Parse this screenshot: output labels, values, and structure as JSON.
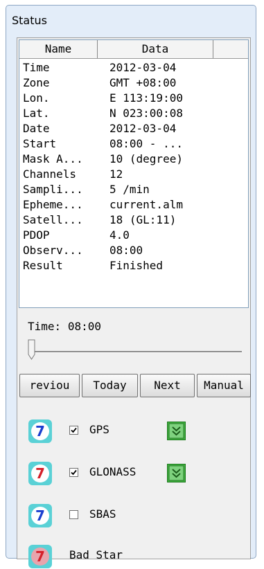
{
  "panel": {
    "title": "Status"
  },
  "list": {
    "columns": [
      "Name",
      "Data"
    ],
    "rows": [
      {
        "name": "Time",
        "value": "2012-03-04"
      },
      {
        "name": "Zone",
        "value": "GMT +08:00"
      },
      {
        "name": "Lon.",
        "value": "E 113:19:00"
      },
      {
        "name": "Lat.",
        "value": "N 023:00:08"
      },
      {
        "name": "Date",
        "value": "2012-03-04"
      },
      {
        "name": "Start",
        "value": "08:00 - ..."
      },
      {
        "name": "Mask A...",
        "value": "10 (degree)"
      },
      {
        "name": "Channels",
        "value": "12"
      },
      {
        "name": "Sampli...",
        "value": "5 /min"
      },
      {
        "name": "Epheme...",
        "value": "current.alm"
      },
      {
        "name": "Satell...",
        "value": "18 (GL:11)"
      },
      {
        "name": "PDOP",
        "value": "4.0"
      },
      {
        "name": "Observ...",
        "value": "08:00"
      },
      {
        "name": "Result",
        "value": "Finished"
      }
    ]
  },
  "time": {
    "label": "Time:",
    "value": "08:00",
    "slider_fraction": 0.0
  },
  "buttons": {
    "previous": "reviou",
    "today": "Today",
    "next": "Next",
    "manual": "Manual"
  },
  "satellites": [
    {
      "label": "GPS",
      "checked": true,
      "icon": "satellite-7-icon",
      "icon_color": "#1a3fcf",
      "has_button": true
    },
    {
      "label": "GLONASS",
      "checked": true,
      "icon": "satellite-7-icon",
      "icon_color": "#d4202a",
      "has_button": true
    },
    {
      "label": "SBAS",
      "checked": false,
      "icon": "satellite-7-icon",
      "icon_color": "#1a3fcf",
      "has_button": false
    },
    {
      "label": "Bad Star",
      "checked": null,
      "icon": "satellite-7-icon",
      "icon_color": "#d4202a",
      "has_button": false
    }
  ],
  "icon_glyph": "7",
  "check_mark": "✓",
  "colors": {
    "icon_ring": "#5ad1d6",
    "green_button": "#3fae3f"
  }
}
